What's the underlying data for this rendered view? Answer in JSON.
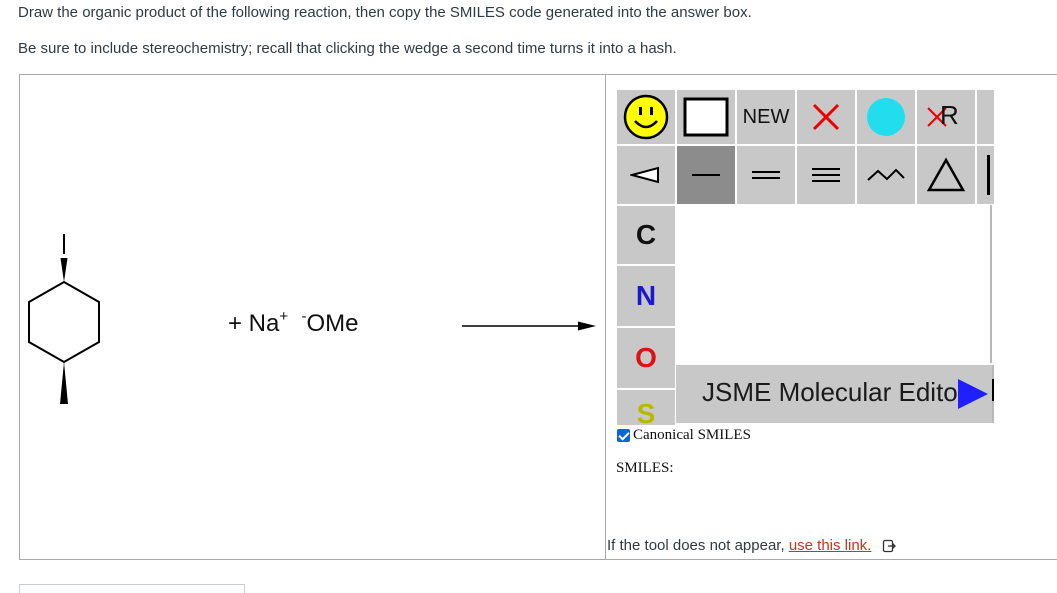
{
  "instructions": {
    "line1": "Draw the organic product of the following reaction, then copy the SMILES code generated into the answer box.",
    "line2": "Be sure to include stereochemistry; recall that clicking the wedge a second time turns it into a hash."
  },
  "reaction": {
    "reagent_prefix": "+ Na",
    "cation_charge": "+",
    "anion_charge": "-",
    "anion": "OMe"
  },
  "jsme": {
    "toolbar_row1": {
      "new_label": "NEW",
      "r_label": "R"
    },
    "elements": [
      "C",
      "N",
      "O",
      "S"
    ],
    "element_colors": {
      "C": "#111111",
      "N": "#1a1acc",
      "O": "#dd1111",
      "S": "#b8b800"
    },
    "logo_text": "JSME Molecular Editor"
  },
  "options": {
    "canonical_label": "Canonical SMILES",
    "canonical_checked": true,
    "smiles_label": "SMILES:"
  },
  "fallback": {
    "text": "If the tool does not appear, ",
    "link_text": "use this link."
  }
}
